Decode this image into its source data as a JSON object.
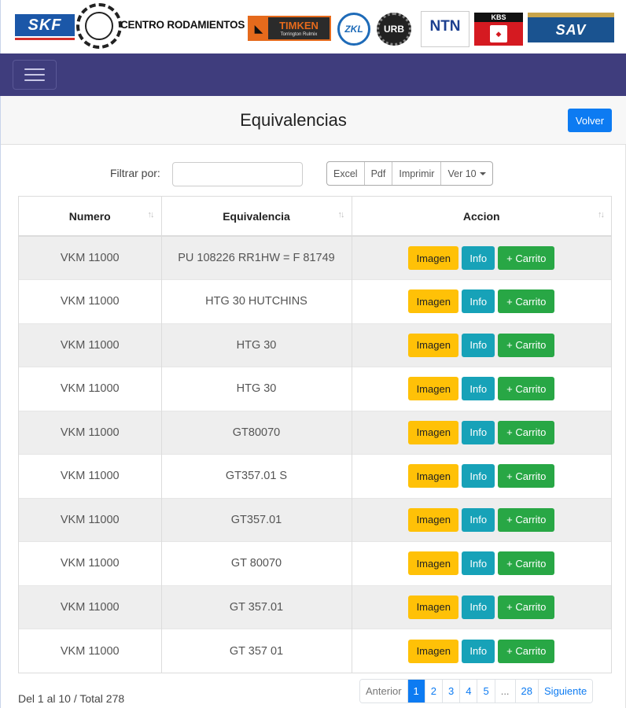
{
  "brands": {
    "skf": "SKF",
    "centro": "CENTRO RODAMIENTOS S.R.L.",
    "timken": "TIMKEN",
    "timken_sub": "Torrington Rulmix",
    "zkl": "ZKL",
    "urb": "URB",
    "ntn": "NTN",
    "kbs": "KBS",
    "sav": "SAV"
  },
  "header": {
    "title": "Equivalencias",
    "back_label": "Volver"
  },
  "toolbar": {
    "filter_label": "Filtrar por:",
    "filter_value": "",
    "excel_label": "Excel",
    "pdf_label": "Pdf",
    "print_label": "Imprimir",
    "show_label": "Ver 10"
  },
  "table": {
    "columns": [
      "Numero",
      "Equivalencia",
      "Accion"
    ],
    "action_labels": {
      "image": "Imagen",
      "info": "Info",
      "cart": "+ Carrito"
    },
    "rows": [
      {
        "numero": "VKM 11000",
        "equivalencia": "PU 108226 RR1HW = F 81749"
      },
      {
        "numero": "VKM 11000",
        "equivalencia": "HTG 30 HUTCHINS"
      },
      {
        "numero": "VKM 11000",
        "equivalencia": "HTG 30"
      },
      {
        "numero": "VKM 11000",
        "equivalencia": "HTG 30"
      },
      {
        "numero": "VKM 11000",
        "equivalencia": "GT80070"
      },
      {
        "numero": "VKM 11000",
        "equivalencia": "GT357.01 S"
      },
      {
        "numero": "VKM 11000",
        "equivalencia": "GT357.01"
      },
      {
        "numero": "VKM 11000",
        "equivalencia": "GT 80070"
      },
      {
        "numero": "VKM 11000",
        "equivalencia": "GT 357.01"
      },
      {
        "numero": "VKM 11000",
        "equivalencia": "GT 357 01"
      }
    ]
  },
  "footer": {
    "info": "Del 1 al 10 / Total 278",
    "pagination": {
      "prev": "Anterior",
      "pages": [
        "1",
        "2",
        "3",
        "4",
        "5",
        "...",
        "28"
      ],
      "next": "Siguiente",
      "active_page": "1"
    }
  }
}
